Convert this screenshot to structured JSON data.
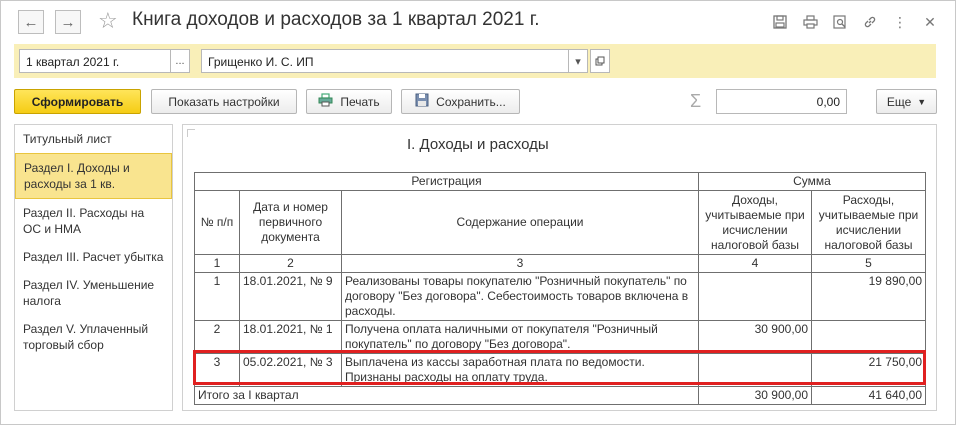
{
  "window": {
    "title": "Книга доходов и расходов за 1 квартал 2021 г."
  },
  "params": {
    "period": "1 квартал 2021 г.",
    "period_btn": "...",
    "organization": "Грищенко И. С. ИП"
  },
  "toolbar": {
    "generate_label": "Сформировать",
    "settings_label": "Показать настройки",
    "print_label": "Печать",
    "save_label": "Сохранить...",
    "sum_value": "0,00",
    "more_label": "Еще"
  },
  "sidebar": {
    "items": [
      {
        "label": "Титульный лист"
      },
      {
        "label": "Раздел I. Доходы и расходы за 1 кв."
      },
      {
        "label": "Раздел II. Расходы на ОС и НМА"
      },
      {
        "label": "Раздел III. Расчет убытка"
      },
      {
        "label": "Раздел IV. Уменьшение налога"
      },
      {
        "label": "Раздел V. Уплаченный торговый сбор"
      }
    ]
  },
  "report": {
    "title": "I. Доходы и расходы",
    "headers": {
      "registration": "Регистрация",
      "sum": "Сумма",
      "num": "№ п/п",
      "date": "Дата и номер первичного документа",
      "content": "Содержание операции",
      "income": "Доходы, учитываемые при исчислении налоговой базы",
      "expense": "Расходы, учитываемые при исчислении налоговой базы"
    },
    "col_numbers": [
      "1",
      "2",
      "3",
      "4",
      "5"
    ],
    "rows": [
      {
        "num": "1",
        "date": "18.01.2021, № 9",
        "content": "Реализованы товары покупателю \"Розничный покупатель\" по договору \"Без договора\". Себестоимость товаров включена в расходы.",
        "income": "",
        "expense": "19 890,00"
      },
      {
        "num": "2",
        "date": "18.01.2021, № 1",
        "content": "Получена оплата наличными от покупателя \"Розничный покупатель\" по договору \"Без договора\".",
        "income": "30 900,00",
        "expense": ""
      },
      {
        "num": "3",
        "date": "05.02.2021, № 3",
        "content": "Выплачена из кассы заработная плата по ведомости. Признаны расходы на оплату труда.",
        "income": "",
        "expense": "21 750,00"
      }
    ],
    "total": {
      "label": "Итого за I квартал",
      "income": "30 900,00",
      "expense": "41 640,00"
    }
  },
  "colors": {
    "accent_yellow": "#f5cc14",
    "params_bg": "#f9efb8",
    "active_item_bg": "#f9e48f",
    "highlight_border": "#e02020"
  }
}
